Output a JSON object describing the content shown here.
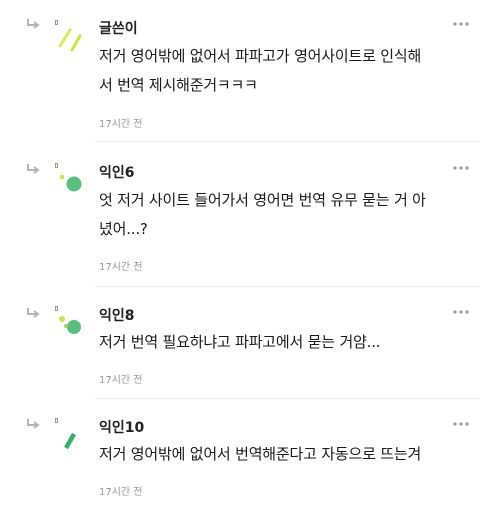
{
  "comments": [
    {
      "author": "글쓴이",
      "lines": [
        "저거 영어밖에 없어서 파파고가 영어사이트로 인식해",
        "서 번역 제시해준거ㅋㅋㅋ"
      ],
      "time": "17시간 전",
      "avatar": "author-avatar-icon"
    },
    {
      "author": "익인6",
      "lines": [
        "엇 저거 사이트 들어가서 영어면 번역 유무 묻는 거 아",
        "녔어...?"
      ],
      "time": "17시간 전",
      "avatar": "dot-avatar-icon"
    },
    {
      "author": "익인8",
      "lines": [
        "저거 번역 필요하냐고 파파고에서 묻는 거얌..."
      ],
      "time": "17시간 전",
      "avatar": "dots-avatar-icon"
    },
    {
      "author": "익인10",
      "lines": [
        "저거 영어밖에 없어서 번역해준다고 자동으로 뜨는겨"
      ],
      "time": "17시간 전",
      "avatar": "stick-avatar-icon"
    }
  ],
  "colors": {
    "accent_green": "#7ac86e",
    "accent_lime": "#c8e63c",
    "accent_dark_green": "#2fb36a"
  }
}
